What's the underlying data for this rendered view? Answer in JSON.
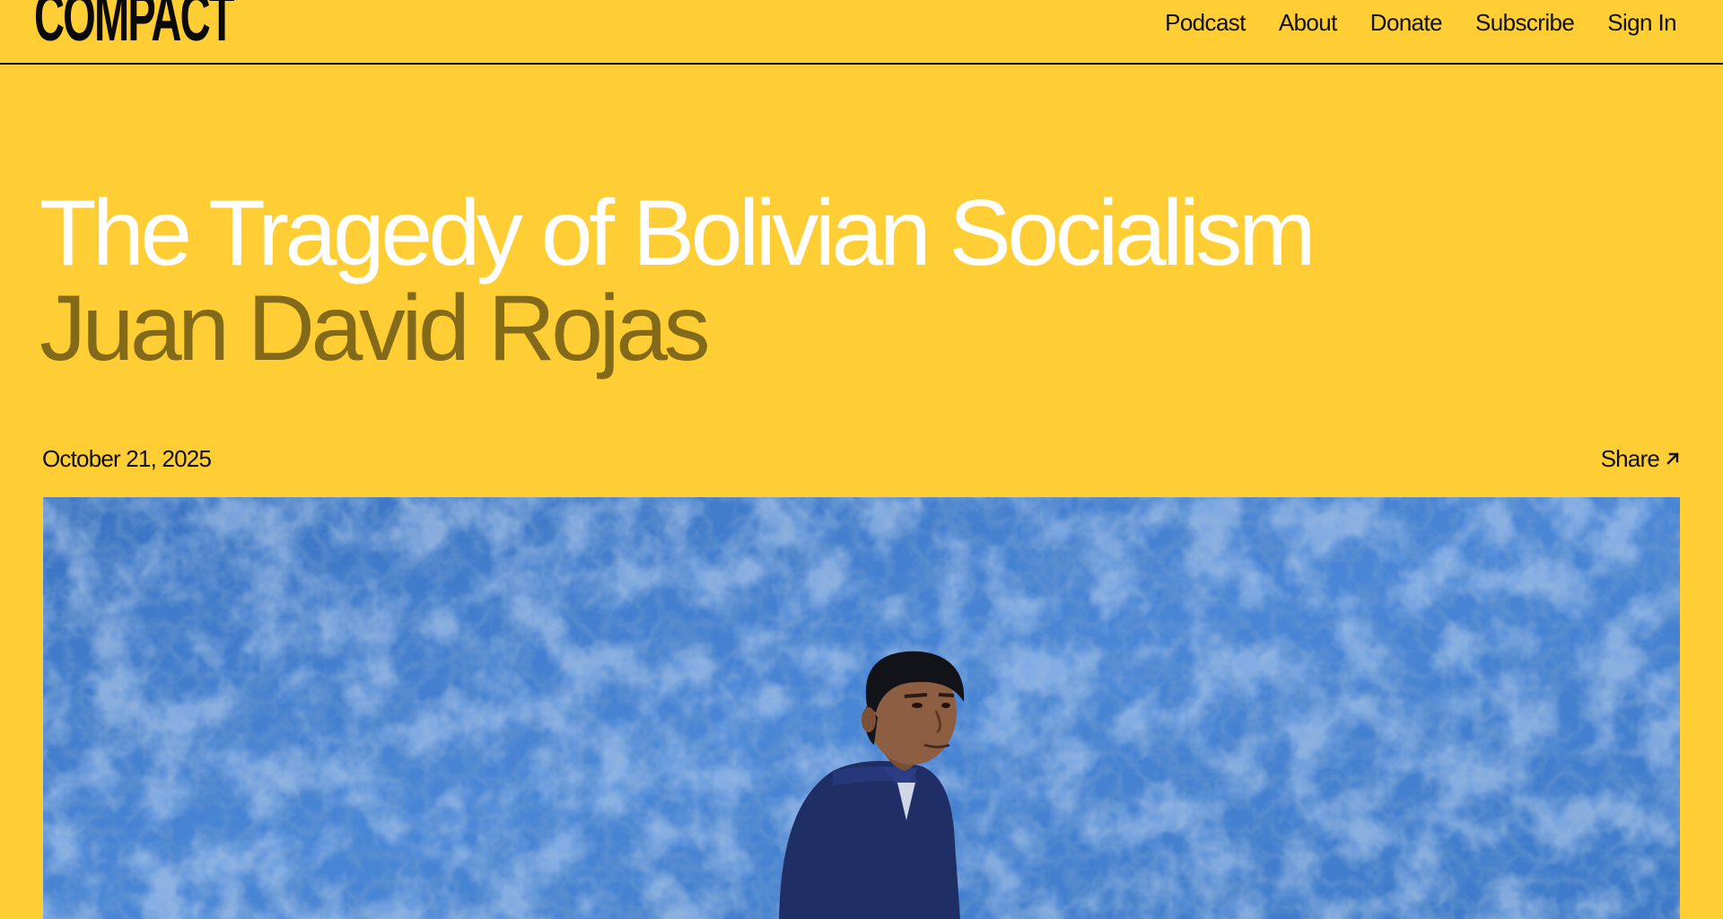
{
  "header": {
    "logo_text": "COMPACT",
    "nav": {
      "podcast": "Podcast",
      "about": "About",
      "donate": "Donate",
      "subscribe": "Subscribe",
      "sign_in": "Sign In"
    }
  },
  "article": {
    "title": "The Tragedy of Bolivian Socialism",
    "author": "Juan David Rojas",
    "date": "October 21, 2025",
    "share_label": "Share"
  },
  "icons": {
    "share": "arrow-up-right-icon"
  },
  "colors": {
    "background": "#FFCE34",
    "title": "#FFFFFF",
    "author": "#826A1A",
    "text": "#111111",
    "hero_blue": "#3F7CCC"
  }
}
